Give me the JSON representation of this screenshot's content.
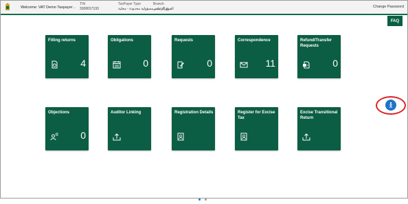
{
  "header": {
    "welcome": "Welcome: VAT Demo Taxpayer ..",
    "tin_label": "TIN",
    "tin_value": "3100017133",
    "taxpayer_type_label": "TaxPayer Type",
    "taxpayer_type_value": "شركة ذات مسؤولية محدودة - محلية",
    "branch_label": "Branch",
    "branch_value": "الفرع الرئيسي",
    "change_password": "Change Password",
    "faq": "FAQ"
  },
  "tiles": [
    {
      "title": "Filling returns",
      "count": "4",
      "icon": "return-doc-icon"
    },
    {
      "title": "Obligations",
      "count": "0",
      "icon": "calendar-icon"
    },
    {
      "title": "Requests",
      "count": "0",
      "icon": "edit-doc-icon"
    },
    {
      "title": "Correspondence",
      "count": "11",
      "icon": "envelope-icon"
    },
    {
      "title": "Refund/Transfer Requests",
      "count": "0",
      "icon": "refund-icon"
    },
    {
      "title": "Objections",
      "count": "0",
      "icon": "user-objection-icon"
    },
    {
      "title": "Auditor Linking",
      "count": "",
      "icon": "upload-icon"
    },
    {
      "title": "Registration Details",
      "count": "",
      "icon": "id-card-icon"
    },
    {
      "title": "Register for Excise Tax",
      "count": "",
      "icon": "id-card-icon"
    },
    {
      "title": "Excise Transitional Return",
      "count": "",
      "icon": "upload-icon"
    }
  ],
  "help_button": {
    "icon": "help-figure-icon"
  },
  "pagination": {
    "pages": 2,
    "active": 1
  },
  "colors": {
    "tile": "#0b5e43",
    "accent": "#1e73c6",
    "annotation": "#e02020"
  }
}
